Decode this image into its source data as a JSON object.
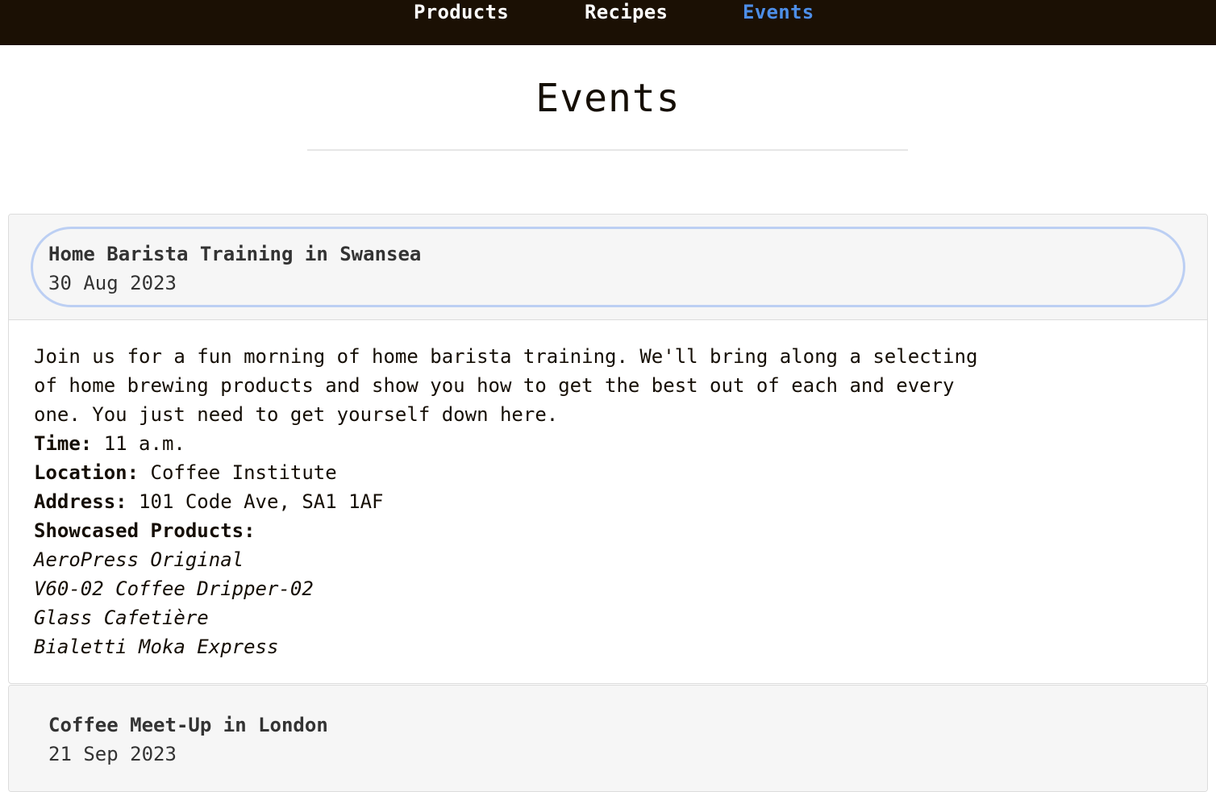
{
  "nav": {
    "products": "Products",
    "recipes": "Recipes",
    "events": "Events"
  },
  "page": {
    "title": "Events"
  },
  "events": [
    {
      "name": "Home Barista Training in Swansea",
      "date": "30 Aug 2023",
      "description": "Join us for a fun morning of home barista training. We'll bring along a selecting of home brewing products and show you how to get the best out of each and every one. You just need to get yourself down here.",
      "time_label": "Time:",
      "time": "11 a.m.",
      "location_label": "Location:",
      "location": "Coffee Institute",
      "address_label": "Address:",
      "address": "101 Code Ave, SA1 1AF",
      "products_label": "Showcased Products:",
      "products": [
        "AeroPress Original",
        "V60-02 Coffee Dripper-02",
        "Glass Cafetière",
        "Bialetti Moka Express"
      ]
    },
    {
      "name": "Coffee Meet-Up in London",
      "date": "21 Sep 2023"
    }
  ],
  "colors": {
    "nav_bg": "#1b1004",
    "nav_active": "#4d8ee8",
    "focus_ring": "#bccff3",
    "header_bg": "#f6f6f6"
  }
}
